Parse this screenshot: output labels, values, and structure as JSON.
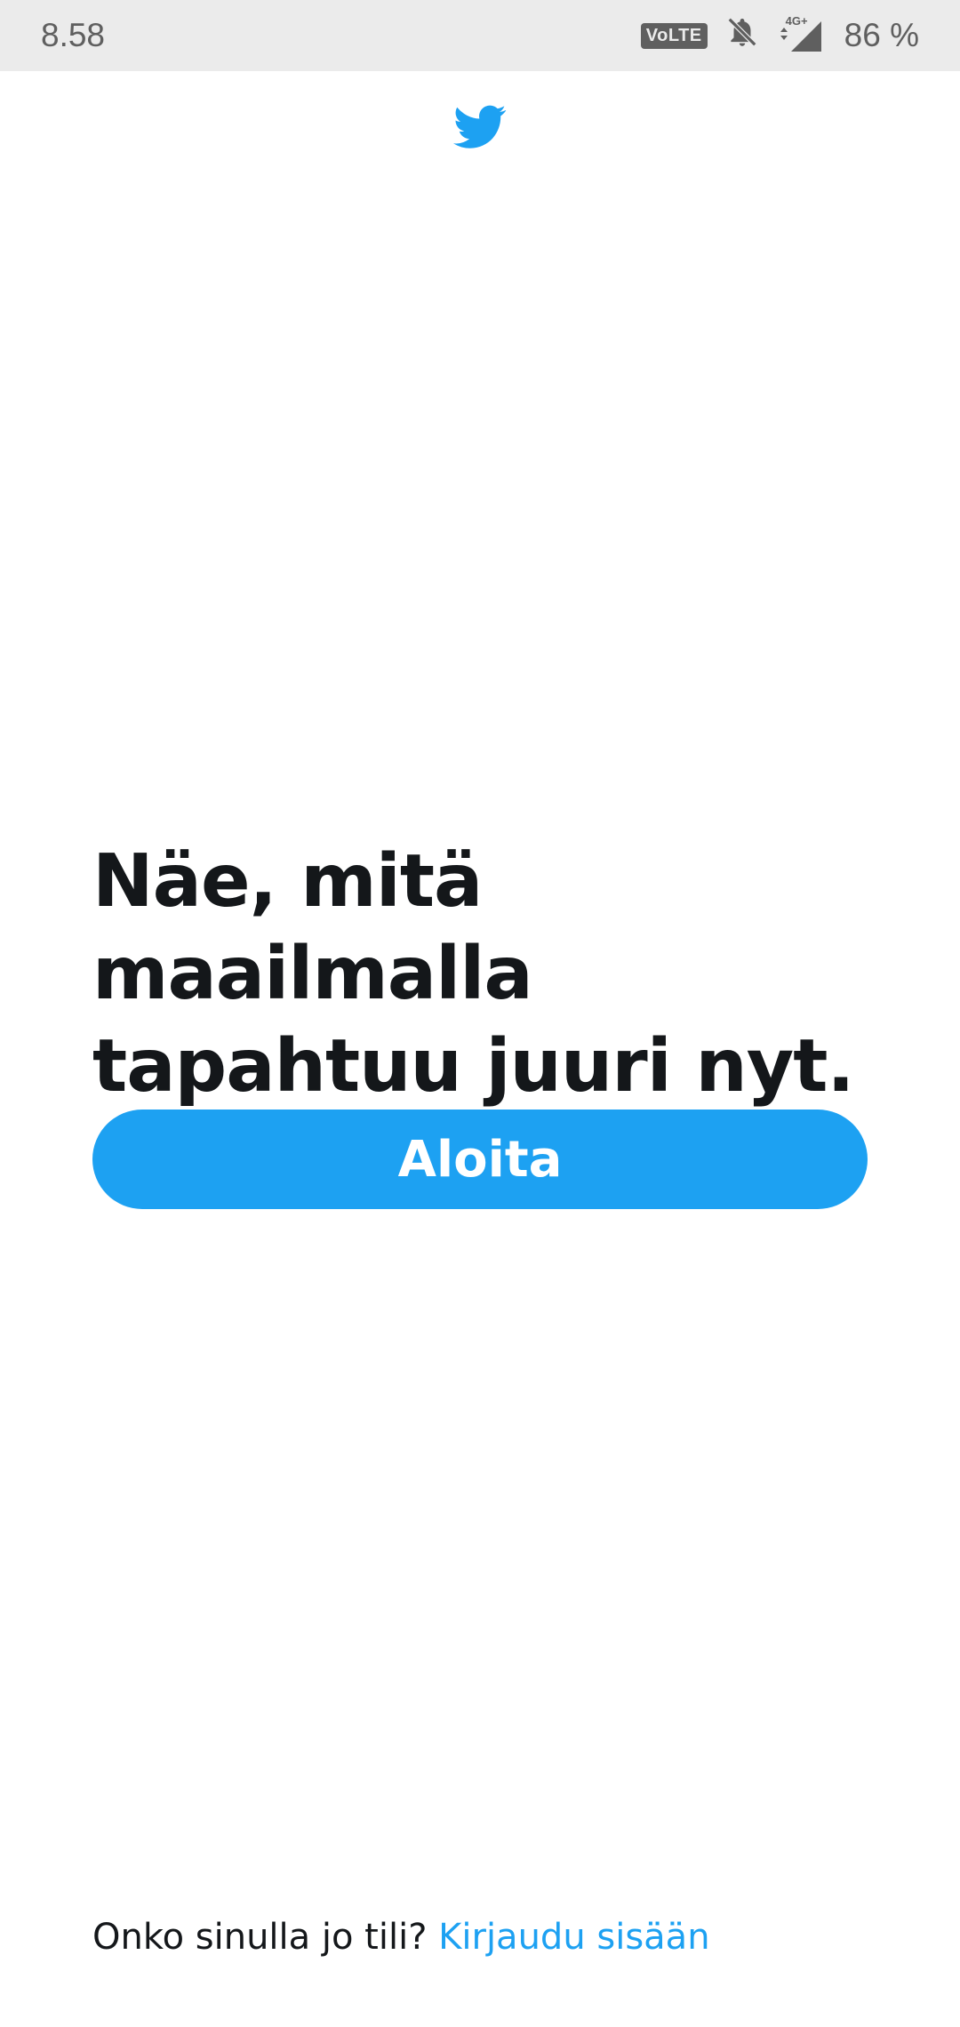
{
  "status_bar": {
    "time": "8.58",
    "volte_label": "VoLTE",
    "network_label": "4G+",
    "battery": "86 %",
    "icons": [
      "volte-icon",
      "bell-off-icon",
      "signal-icon"
    ]
  },
  "app": {
    "logo_icon": "twitter-bird-icon",
    "brand_color": "#1da1f2",
    "text_color": "#14171a"
  },
  "main": {
    "headline": "Näe, mitä maailmalla tapahtuu juuri nyt.",
    "start_button_label": "Aloita"
  },
  "footer": {
    "prompt_text": "Onko sinulla jo tili?",
    "login_link_label": "Kirjaudu sisään"
  }
}
